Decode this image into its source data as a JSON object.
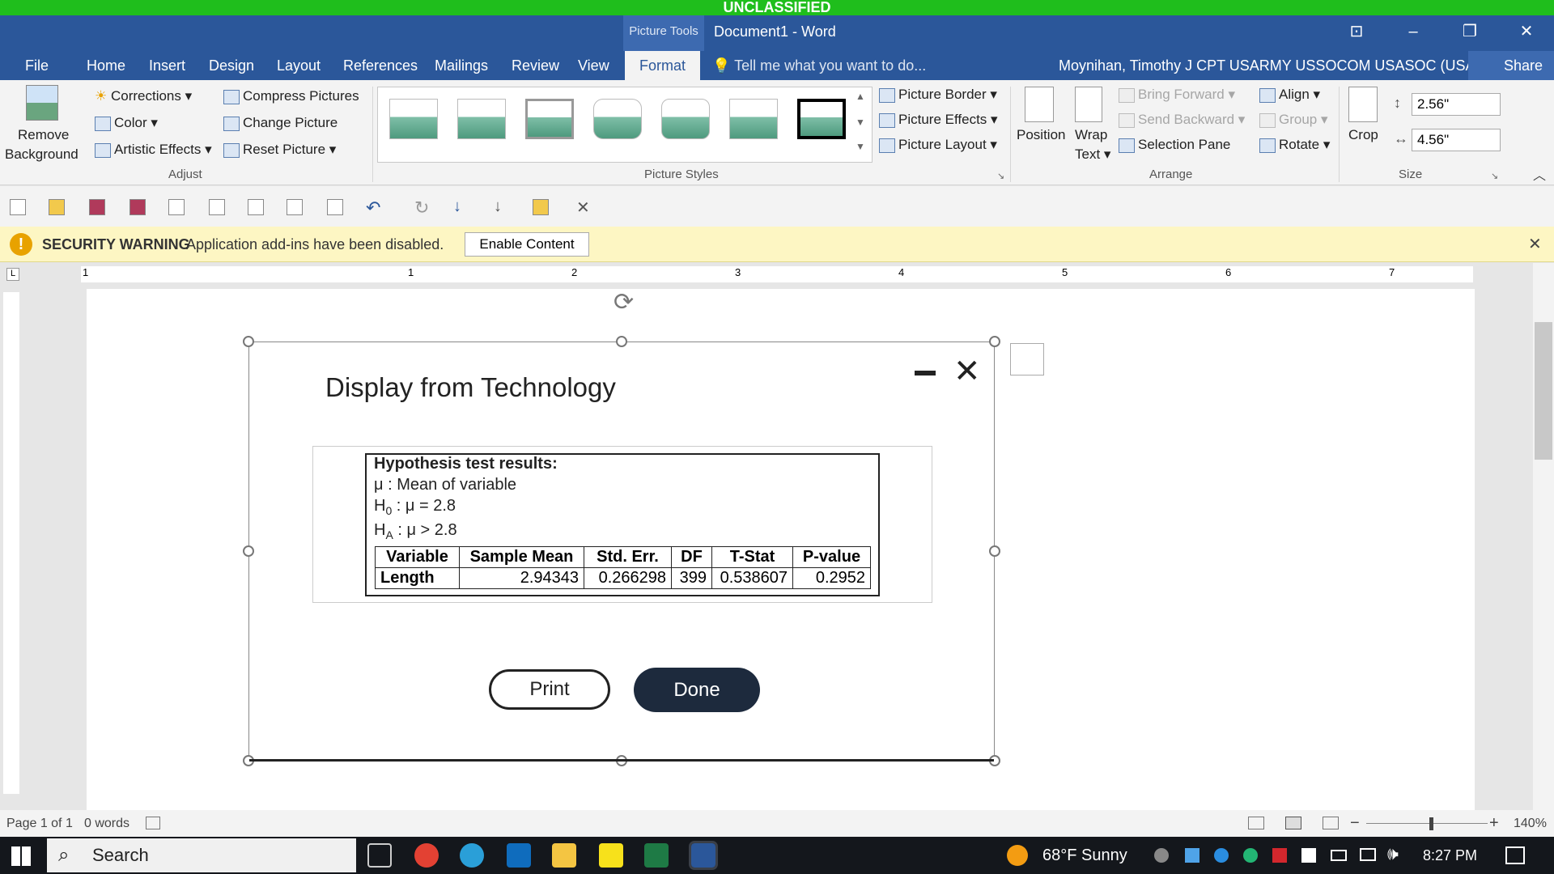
{
  "banner": "UNCLASSIFIED",
  "titlebar": {
    "context_tab": "Picture Tools",
    "doc_title": "Document1 - Word",
    "tell_me": "Tell me what you want to do...",
    "user": "Moynihan, Timothy J CPT USARMY USSOCOM USASOC (USA)",
    "share": "Share"
  },
  "menu": [
    "File",
    "Home",
    "Insert",
    "Design",
    "Layout",
    "References",
    "Mailings",
    "Review",
    "View",
    "Format"
  ],
  "ribbon": {
    "remove_background": [
      "Remove",
      "Background"
    ],
    "corrections": "Corrections",
    "color": "Color",
    "artistic_effects": "Artistic Effects",
    "compress": "Compress Pictures",
    "change": "Change Picture",
    "reset": "Reset Picture",
    "adjust_group": "Adjust",
    "styles_group": "Picture Styles",
    "border": "Picture Border",
    "effects": "Picture Effects",
    "layout": "Picture Layout",
    "position": "Position",
    "wrap": [
      "Wrap",
      "Text"
    ],
    "bring_forward": "Bring Forward",
    "send_backward": "Send Backward",
    "selection_pane": "Selection Pane",
    "align": "Align",
    "group": "Group",
    "rotate": "Rotate",
    "arrange_group": "Arrange",
    "crop": "Crop",
    "height": "2.56\"",
    "width": "4.56\"",
    "size_group": "Size"
  },
  "security": {
    "title": "SECURITY WARNING",
    "message": "Application add-ins have been disabled.",
    "button": "Enable Content"
  },
  "ruler_numbers": [
    "1",
    "1",
    "2",
    "3",
    "4",
    "5",
    "6",
    "7"
  ],
  "dialog": {
    "title": "Display from Technology",
    "heading": "Hypothesis test results:",
    "mu_line": "μ : Mean of variable",
    "h0_prefix": "H",
    "h0_sub": "0",
    "h0_text": " : μ = 2.8",
    "ha_prefix": "H",
    "ha_sub": "A",
    "ha_text": " : μ > 2.8",
    "columns": [
      "Variable",
      "Sample Mean",
      "Std. Err.",
      "DF",
      "T-Stat",
      "P-value"
    ],
    "row": [
      "Length",
      "2.94343",
      "0.266298",
      "399",
      "0.538607",
      "0.2952"
    ],
    "print": "Print",
    "done": "Done"
  },
  "status": {
    "page": "Page 1 of 1",
    "words": "0 words",
    "zoom": "140%"
  },
  "taskbar": {
    "search": "Search",
    "weather": "68°F  Sunny",
    "time": "8:27 PM"
  }
}
